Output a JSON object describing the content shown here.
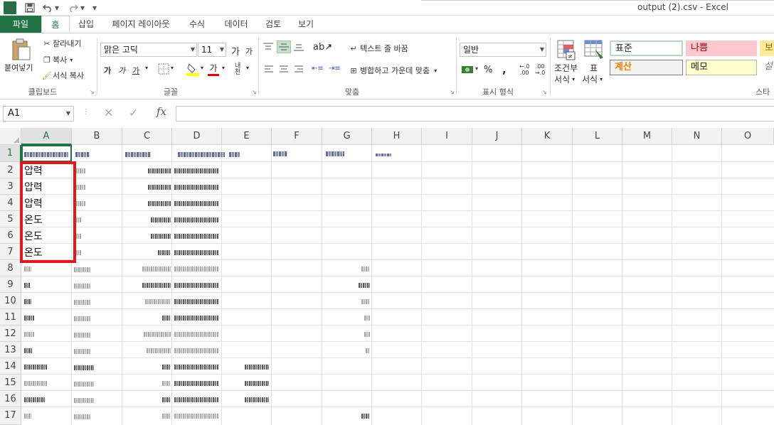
{
  "app": {
    "logo_label": "X",
    "title": "output (2).csv - Excel",
    "accent": "#217346"
  },
  "quick_access": {
    "save_icon": "floppy-disk-icon",
    "undo_icon": "undo-icon",
    "redo_icon": "redo-icon"
  },
  "tabs": [
    {
      "label": "파일"
    },
    {
      "label": "홈"
    },
    {
      "label": "삽입"
    },
    {
      "label": "페이지 레이아웃"
    },
    {
      "label": "수식"
    },
    {
      "label": "데이터"
    },
    {
      "label": "검토"
    },
    {
      "label": "보기"
    }
  ],
  "ribbon": {
    "clipboard": {
      "paste": "붙여넣기",
      "cut": "잘라내기",
      "copy": "복사",
      "format_painter": "서식 복사",
      "group": "클립보드"
    },
    "font": {
      "name": "맑은 고딕",
      "size": "11",
      "grow": "가",
      "shrink": "가",
      "bold": "가",
      "italic": "가",
      "underline": "가",
      "font_color": "가",
      "phonetic": "내천",
      "group": "글꼴"
    },
    "alignment": {
      "wrap": "텍스트 줄 바꿈",
      "merge": "병합하고 가운데 맞춤",
      "group": "맞춤"
    },
    "number": {
      "format": "일반",
      "percent": "%",
      "comma": ",",
      "group": "표시 형식"
    },
    "styles": {
      "conditional_l1": "조건부",
      "conditional_l2": "서식",
      "table_l1": "표",
      "table_l2": "서식",
      "normal": "표준",
      "bad": "나쁨",
      "good": "보",
      "calc": "계산",
      "note": "메모",
      "explain": "설",
      "group": "스타"
    }
  },
  "formula_bar": {
    "name_box": "A1",
    "fx": "fx",
    "cancel": "✕",
    "enter": "✓"
  },
  "columns": [
    "A",
    "B",
    "C",
    "D",
    "E",
    "F",
    "G",
    "H",
    "I",
    "J",
    "K",
    "L",
    "M",
    "N",
    "O"
  ],
  "rows": [
    "1",
    "2",
    "3",
    "4",
    "5",
    "6",
    "7",
    "8",
    "9",
    "10",
    "11",
    "12",
    "13",
    "14",
    "15",
    "16",
    "17"
  ],
  "cells_A": [
    "압력",
    "압력",
    "압력",
    "온도",
    "온도",
    "온도"
  ]
}
